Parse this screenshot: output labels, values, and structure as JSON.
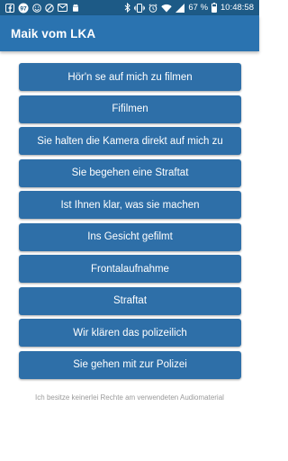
{
  "status_bar": {
    "notification_badge": "97",
    "battery_percent": "67 %",
    "time": "10:48:58",
    "left_icons": [
      "facebook-icon",
      "notification-count-badge-icon",
      "smiley-icon",
      "block-icon",
      "mail-icon",
      "android-icon"
    ],
    "right_icons": [
      "bluetooth-icon",
      "vibrate-icon",
      "alarm-icon",
      "wifi-icon",
      "signal-icon",
      "battery-icon"
    ]
  },
  "app_bar": {
    "title": "Maik vom LKA",
    "color": "#2a73b0"
  },
  "buttons": [
    {
      "label": "Hör'n se auf mich zu filmen"
    },
    {
      "label": "Fifilmen"
    },
    {
      "label": "Sie halten die Kamera direkt auf mich zu"
    },
    {
      "label": "Sie begehen eine Straftat"
    },
    {
      "label": "Ist Ihnen klar, was sie machen"
    },
    {
      "label": "Ins Gesicht gefilmt"
    },
    {
      "label": "Frontalaufnahme"
    },
    {
      "label": "Straftat"
    },
    {
      "label": "Wir klären das polizeilich"
    },
    {
      "label": "Sie gehen mit zur Polizei"
    }
  ],
  "button_color": "#2e6fa8",
  "footer": {
    "disclaimer": "Ich besitze keinerlei Rechte am verwendeten Audiomaterial"
  }
}
